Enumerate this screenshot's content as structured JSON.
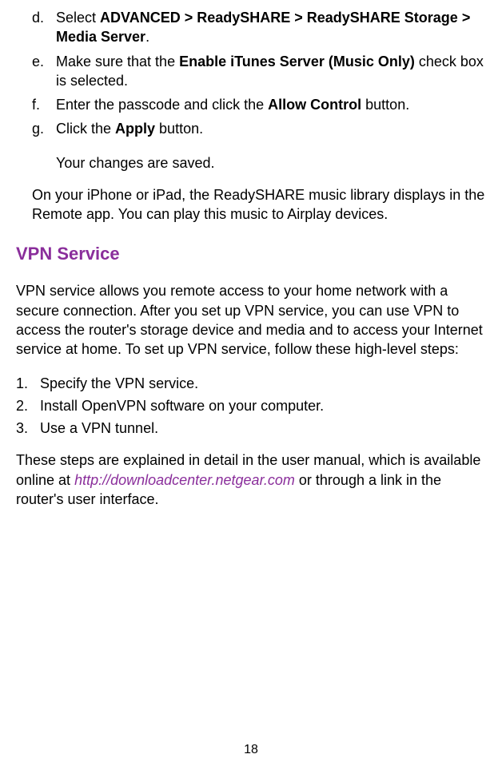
{
  "sub_items": [
    {
      "marker": "d.",
      "pre": "Select ",
      "bold": "ADVANCED > ReadySHARE > ReadySHARE Storage > Media Server",
      "post": "."
    },
    {
      "marker": "e.",
      "pre": "Make sure that the ",
      "bold": "Enable iTunes Server (Music Only)",
      "post": " check box is selected."
    },
    {
      "marker": "f.",
      "pre": "Enter the passcode and click the ",
      "bold": "Allow Control",
      "post": " button."
    },
    {
      "marker": "g.",
      "pre": "Click the ",
      "bold": "Apply",
      "post": " button."
    }
  ],
  "indent_note": "Your changes are saved.",
  "para1": "On your iPhone or iPad, the ReadySHARE music library displays in the Remote app. You can play this music to Airplay devices.",
  "heading": "VPN Service",
  "para2": "VPN service allows you remote access to your home network with a secure connection. After you set up VPN service, you can use VPN to access the router's storage device and media and to access your Internet service at home. To set up VPN service, follow these high-level steps:",
  "num_items": [
    {
      "marker": "1.",
      "text": "Specify the VPN service."
    },
    {
      "marker": "2.",
      "text": "Install OpenVPN software on your computer."
    },
    {
      "marker": "3.",
      "text": "Use a VPN tunnel."
    }
  ],
  "para3_pre": "These steps are explained in detail in the user manual, which is available online at ",
  "para3_link": "http://downloadcenter.netgear.com",
  "para3_post": " or through a link in the router's user interface.",
  "page_number": "18"
}
